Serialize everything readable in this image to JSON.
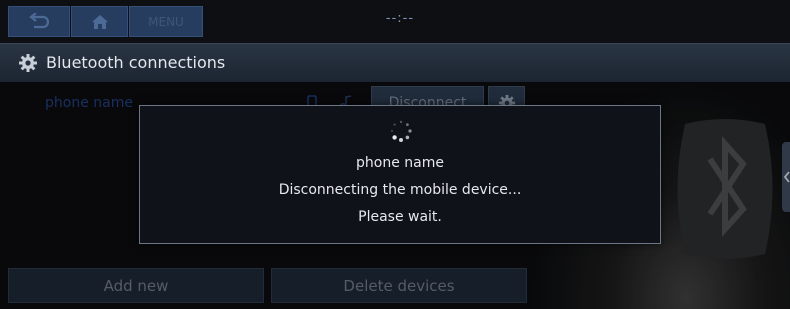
{
  "topbar": {
    "back_icon": "back-arrow-icon",
    "home_icon": "home-icon",
    "menu_label": "MENU",
    "clock": "--:--"
  },
  "titlebar": {
    "icon": "gear-icon",
    "title": "Bluetooth connections"
  },
  "device_list": [
    {
      "name": "phone name",
      "status_icons": [
        "phone-link-icon",
        "music-icon"
      ],
      "action_label": "Disconnect",
      "settings_icon": "gear-icon"
    }
  ],
  "bottom_buttons": {
    "add_new": "Add new",
    "delete_devices": "Delete devices"
  },
  "modal": {
    "spinner_icon": "loading-spinner-icon",
    "device_name": "phone name",
    "status": "Disconnecting the mobile device...",
    "wait": "Please wait."
  },
  "colors": {
    "accent": "#273d5f",
    "title_text": "#e3e7ee",
    "device_name": "#1f3a74",
    "modal_border": "#6d7685"
  }
}
